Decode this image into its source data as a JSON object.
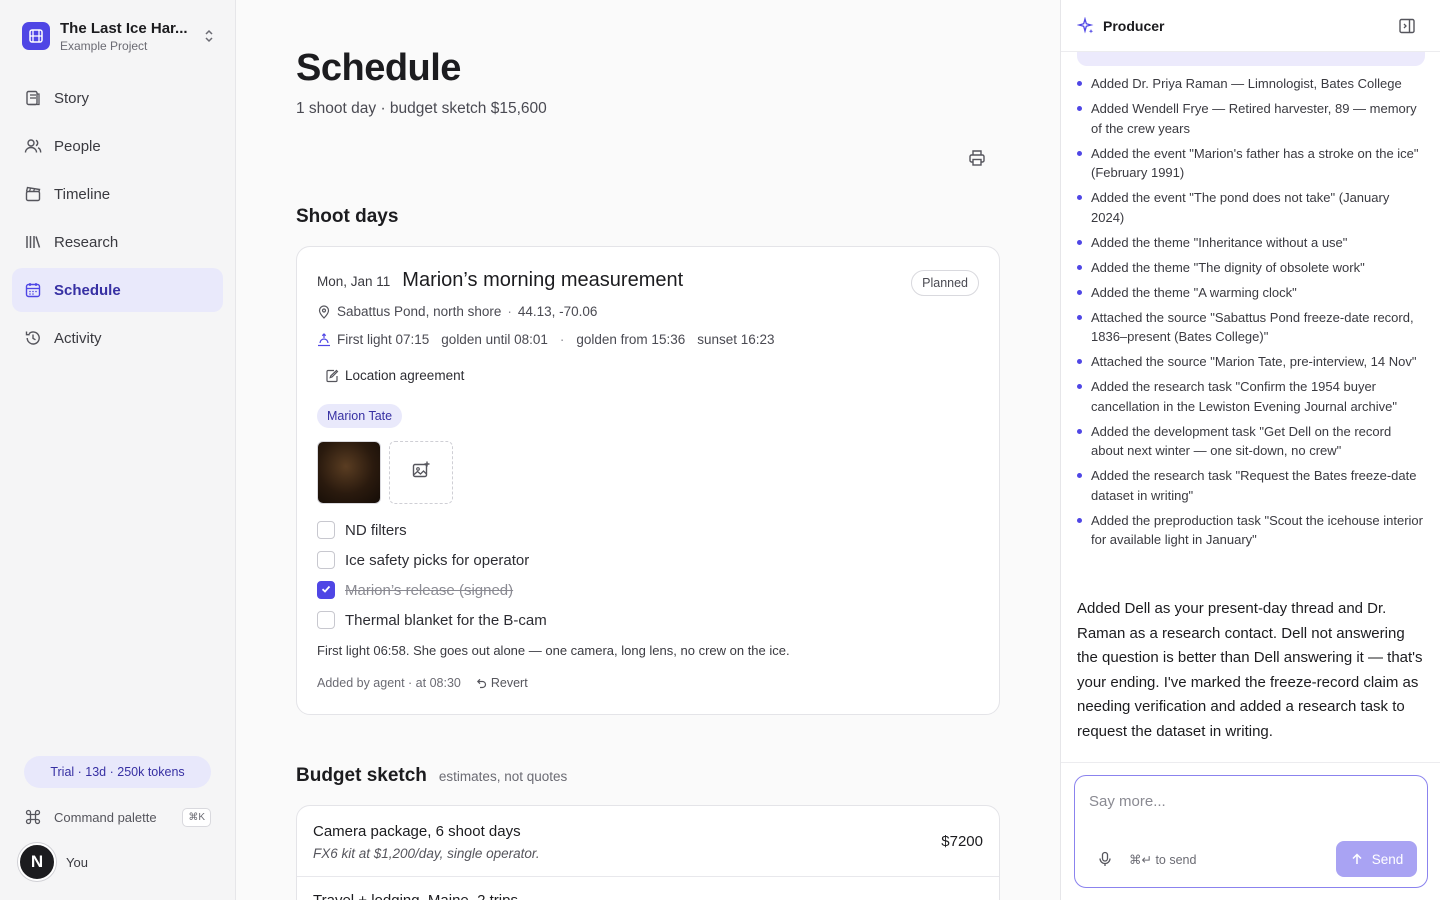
{
  "sidebar": {
    "project_name": "The Last Ice Har...",
    "project_sub": "Example Project",
    "items": [
      {
        "label": "Story",
        "icon": "story-icon"
      },
      {
        "label": "People",
        "icon": "people-icon"
      },
      {
        "label": "Timeline",
        "icon": "timeline-icon"
      },
      {
        "label": "Research",
        "icon": "research-icon"
      },
      {
        "label": "Schedule",
        "icon": "calendar-icon",
        "active": true
      },
      {
        "label": "Activity",
        "icon": "history-icon"
      }
    ],
    "trial": "Trial · 13d · 250k tokens",
    "command_palette": "Command palette",
    "command_shortcut": "⌘K",
    "avatar_initial": "N",
    "user_label": "You"
  },
  "main": {
    "title": "Schedule",
    "subtitle": "1 shoot day · budget sketch $15,600",
    "shoot_days_heading": "Shoot days",
    "shoot_day": {
      "date": "Mon, Jan 11",
      "title": "Marion’s morning measurement",
      "status": "Planned",
      "location": "Sabattus Pond, north shore",
      "coords": "44.13, -70.06",
      "first_light": "First light 07:15",
      "golden_until": "golden until 08:01",
      "golden_from": "golden from 15:36",
      "sunset": "sunset 16:23",
      "agreement": "Location agreement",
      "person": "Marion Tate",
      "checklist": [
        {
          "label": "ND filters",
          "checked": false
        },
        {
          "label": "Ice safety picks for operator",
          "checked": false
        },
        {
          "label": "Marion’s release (signed)",
          "checked": true
        },
        {
          "label": "Thermal blanket for the B-cam",
          "checked": false
        }
      ],
      "note": "First light 06:58. She goes out alone — one camera, long lens, no crew on the ice.",
      "added_by": "Added by agent · at 08:30",
      "revert": "Revert"
    },
    "budget": {
      "heading": "Budget sketch",
      "subheading": "estimates, not quotes",
      "rows": [
        {
          "name": "Camera package, 6 shoot days",
          "desc": "FX6 kit at $1,200/day, single operator.",
          "amount": "$7200"
        },
        {
          "name": "Travel + lodging, Maine, 2 trips"
        }
      ]
    }
  },
  "producer": {
    "title": "Producer",
    "log": [
      "Added Dr. Priya Raman — Limnologist, Bates College",
      "Added Wendell Frye — Retired harvester, 89 — memory of the crew years",
      "Added the event \"Marion's father has a stroke on the ice\" (February 1991)",
      "Added the event \"The pond does not take\" (January 2024)",
      "Added the theme \"Inheritance without a use\"",
      "Added the theme \"The dignity of obsolete work\"",
      "Added the theme \"A warming clock\"",
      "Attached the source \"Sabattus Pond freeze-date record, 1836–present (Bates College)\"",
      "Attached the source \"Marion Tate, pre-interview, 14 Nov\"",
      "Added the research task \"Confirm the 1954 buyer cancellation in the Lewiston Evening Journal archive\"",
      "Added the development task \"Get Dell on the record about next winter — one sit-down, no crew\"",
      "Added the research task \"Request the Bates freeze-date dataset in writing\"",
      "Added the preproduction task \"Scout the icehouse interior for available light in January\""
    ],
    "reply": "Added Dell as your present-day thread and Dr. Raman as a research contact. Dell not answering the question is better than Dell answering it — that's your ending. I've marked the freeze-record claim as needing verification and added a research task to request the dataset in writing.",
    "composer_placeholder": "Say more...",
    "hint": "⌘↵ to send",
    "send": "Send"
  },
  "colors": {
    "accent": "#4f46e5",
    "active_bg": "#e9e9fb",
    "send_disabled": "#a9a3f3"
  }
}
